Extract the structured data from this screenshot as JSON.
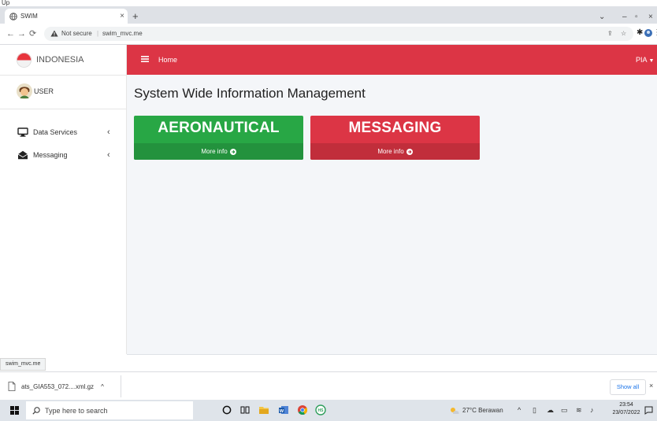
{
  "caption": {
    "text": "Up"
  },
  "browser": {
    "tab_title": "SWIM",
    "tab_close": "×",
    "new_tab": "+",
    "window_controls": {
      "chevron": "⌄",
      "minimize": "–",
      "restore": "▫",
      "close": "×"
    },
    "security_label": "Not secure",
    "url": "swim_mvc.me"
  },
  "sidebar": {
    "brand": "INDONESIA",
    "user": "USER",
    "items": [
      {
        "label": "Data Services",
        "icon": "monitor-icon",
        "arrow": "‹"
      },
      {
        "label": "Messaging",
        "icon": "envelope-open-icon",
        "arrow": "‹"
      }
    ]
  },
  "topbar": {
    "home_label": "Home",
    "account": "PIA"
  },
  "content": {
    "title": "System Wide Information Management",
    "boxes": [
      {
        "title": "AERONAUTICAL",
        "footer": "More info",
        "color": "#28a745"
      },
      {
        "title": "MESSAGING",
        "footer": "More info",
        "color": "#dc3545"
      }
    ]
  },
  "status_url": "swim_mvc.me",
  "downloads": {
    "filename": "ats_GIA553_072....xml.gz",
    "caret": "^",
    "show_all": "Show all",
    "close": "×"
  },
  "taskbar": {
    "search_placeholder": "Type here to search",
    "weather": "27°C Berawan",
    "time": "23:54",
    "date": "23/07/2022",
    "tray_caret": "^"
  },
  "colors": {
    "accent_red": "#dc3545",
    "success_green": "#28a745"
  }
}
